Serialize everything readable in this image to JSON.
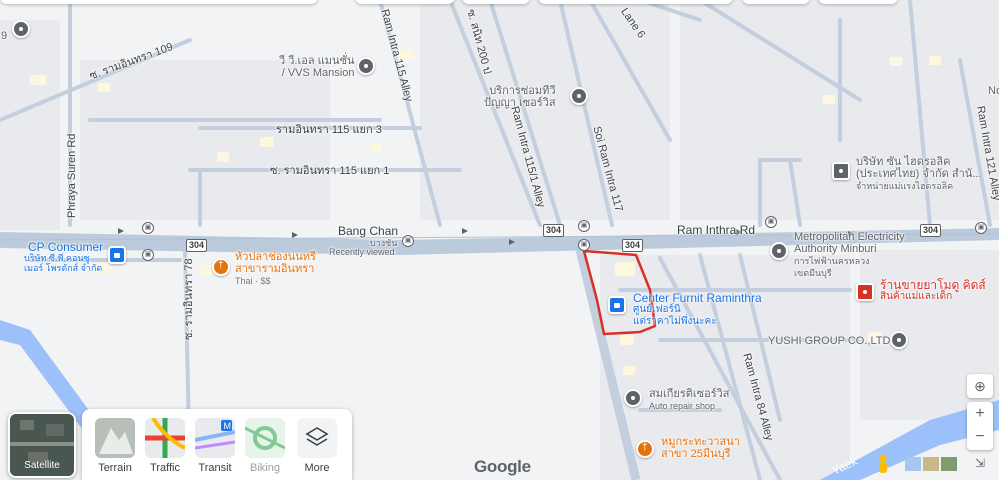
{
  "map": {
    "roads": {
      "main_road_west": "Bang Chan",
      "main_road_east": "Ram Inthra Rd",
      "phraya_suren": "Phraya Suren Rd",
      "soi_109": "ซ. รามอินทรา 109",
      "soi_115_3": "รามอินทรา 115 แยก 3",
      "soi_115_1": "ซ. รามอินทรา 115 แยก 1",
      "ram_115_alley": "Ram Intra 115 Alley",
      "soi_200": "ซ. สนิท 200 ป",
      "ram_115_1_alley": "Ram Intra 115/1 Alley",
      "soi_ram_117": "Soi Ram Intra 117",
      "lane_6": "Lane 6",
      "soi_78": "ซ. รามอินทรา 78",
      "ram_84_alley": "Ram Intra 84 Alley",
      "ram_121_alley": "Ram Intra 121 Alley",
      "yaek": "Yaek",
      "route_shield": "304"
    },
    "pois": {
      "mansion_line1": "วี วี.เอล แมนชั่น",
      "mansion_line2": "/ VVS Mansion",
      "repair_line1": "บริการซ่อมทีวี",
      "repair_line2": "ปัญญา เซอร์วิส",
      "cp_name": "CP Consumer",
      "cp_sub1": "บริษัท ซี.พี.คอนซู",
      "cp_sub2": "เมอร์ โพรดักส์ จำกัด",
      "bangchan_sub": "บางชัน",
      "recently_viewed": "Recently viewed",
      "restaurant_line1": "หัวปลาช่องนนทรี",
      "restaurant_line2": "สาขารามอินทรา",
      "restaurant_meta": "Thai · $$",
      "center_name": "Center Furnit Raminthra",
      "center_sub1": "ศูนย์เฟอร์นิ",
      "center_sub2": "แต่ราคาไม่พึ่งนะคะ",
      "mea_line1": "Metropolitan Electricity",
      "mea_line2": "Authority Minburi",
      "mea_sub1": "การไฟฟ้านครหลวง",
      "mea_sub2": "เขตมีนบุรี",
      "shop_line1": "ร้านขายยาโมดู คิดส์",
      "shop_sub": "สินค้าแม่และเด็ก",
      "yushi": "YUSHI GROUP CO.,LTD",
      "auto_line1": "สมเกียรติเซอร์วิส",
      "auto_sub": "Auto repair shop",
      "food2_line1": "หมูกระทะวาสนา",
      "food2_line2": "สาขา 25มีนบุรี",
      "company_line1": "บริษัท ซัน ไฮดรอลิค",
      "company_line2": "(ประเทศไทย) จำกัด สำนั...",
      "company_sub": "จำหน่ายแม่แรงไฮดรอลิค",
      "edge_num": "9",
      "edge_no": "No"
    }
  },
  "layers": {
    "satellite": "Satellite",
    "terrain": "Terrain",
    "traffic": "Traffic",
    "transit": "Transit",
    "biking": "Biking",
    "more": "More"
  },
  "branding": {
    "google": "Google"
  },
  "colors": {
    "highlight": "#d93025",
    "water": "#9cc0f9",
    "road": "#c3cfde"
  }
}
